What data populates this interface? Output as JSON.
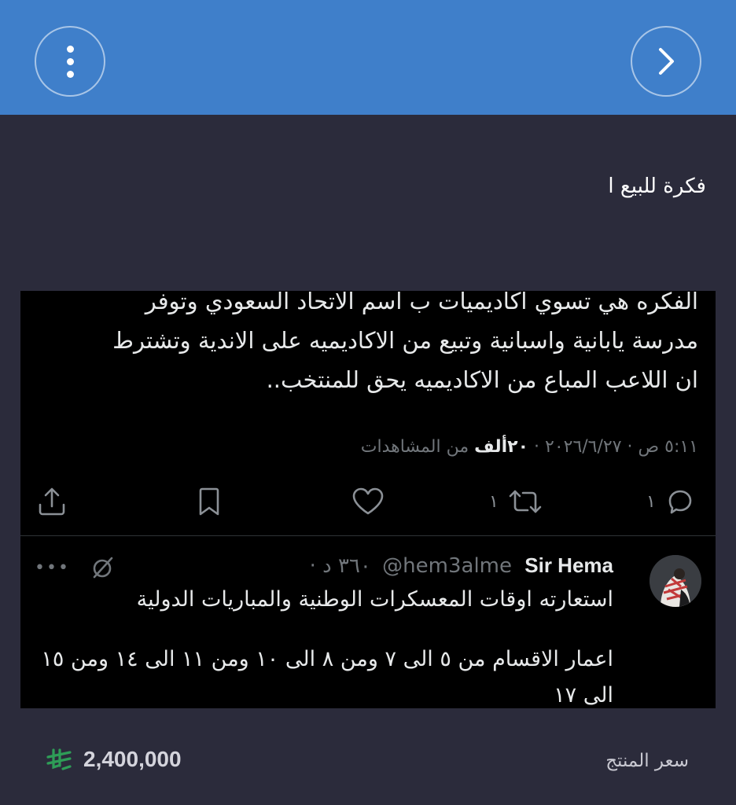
{
  "header": {
    "menu_icon": "vertical-dots-icon",
    "forward_icon": "chevron-right-icon",
    "bar_color": "#3f7fca"
  },
  "product": {
    "title": "فكرة للبيع ا",
    "price_label": "سعر المنتج",
    "price_value": "2,400,000",
    "currency_icon": "saudi-riyal-icon",
    "currency_color": "#2e9d57"
  },
  "tweet": {
    "lines": [
      "الفكره هي تسوي اكاديميات ب اسم الاتحاد السعودي وتوفر",
      "مدرسة يابانية واسبانية وتبيع من الاكاديميه على الاندية وتشترط",
      "ان اللاعب المباع من الاكاديميه يحق للمنتخب.."
    ],
    "timestamp": "٥:١١ ص · ٢٠٢٦/٦/٢٧ ·",
    "views_count": "٢٠ألف",
    "views_label": "من المشاهدات",
    "actions": {
      "reply_count": "١",
      "retweet_count": "١",
      "like_count": "",
      "bookmark_count": "",
      "share_count": ""
    }
  },
  "reply": {
    "name": "Sir Hema",
    "handle": "@hem3alme",
    "time": "· ٣٦٠ د",
    "line1": "استعارته اوقات المعسكرات الوطنية والمباريات الدولية",
    "line2": "اعمار الاقسام من ٥ الى ٧ ومن ٨ الى ١٠ ومن ١١ الى ١٤ ومن ١٥ الى ١٧"
  }
}
